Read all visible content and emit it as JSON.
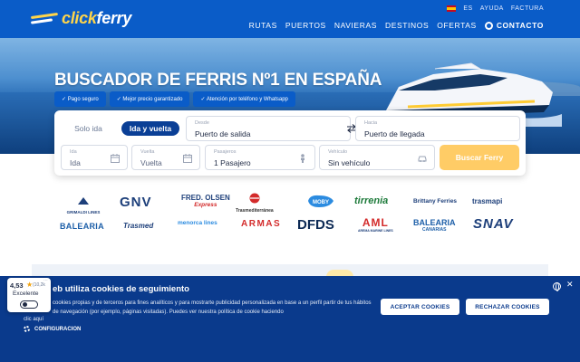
{
  "header": {
    "logo_part1": "click",
    "logo_part2": "ferry",
    "top_links": [
      "ES",
      "AYUDA",
      "FACTURA"
    ],
    "nav": [
      "RUTAS",
      "PUERTOS",
      "NAVIERAS",
      "DESTINOS",
      "OFERTAS"
    ],
    "contact_label": "CONTACTO"
  },
  "hero": {
    "title": "BUSCADOR DE FERRIS Nº1 EN ESPAÑA",
    "badges": [
      "✓ Pago seguro",
      "✓ Mejor precio garantizado",
      "✓ Atención por teléfono y Whatsapp"
    ]
  },
  "search": {
    "trip_one_way": "Solo ida",
    "trip_round": "Ida y vuelta",
    "from_label": "Desde",
    "from_value": "Puerto de salida",
    "to_label": "Hacia",
    "to_value": "Puerto de llegada",
    "date_out_label": "Ida",
    "date_out_value": "Ida",
    "date_back_label": "Vuelta",
    "date_back_value": "Vuelta",
    "passengers_label": "Pasajeros",
    "passengers_value": "1 Pasajero",
    "vehicle_label": "Vehículo",
    "vehicle_value": "Sin vehículo",
    "button": "Buscar Ferry"
  },
  "carriers": {
    "grimaldi": "GRIMALDI LINES",
    "gnv": "GNV",
    "fredolsen_1": "FRED. OLSEN",
    "fredolsen_2": "Express",
    "trasmed_alt": "Trasmediterránea",
    "moby": "MOBY",
    "tirrenia": "tirrenia",
    "brittany": "Brittany Ferries",
    "trasmapi": "trasmapi",
    "balearia": "BALEARIA",
    "trasmed": "Trasmed",
    "menorca": "menorca lines",
    "armas": "ARMAS",
    "dfds": "DFDS",
    "aml": "AML",
    "aml_sub": "AREMA MARINE LINES",
    "balearia_canarias_1": "BALEARIA",
    "balearia_canarias_2": "CANARIAS",
    "snav": "SNAV"
  },
  "cookie": {
    "title": "eb utiliza cookies de seguimiento",
    "text": "cookies propias y de terceros para fines analíticos y para mostrarte publicidad personalizada en base a un perfil partir de tus hábitos de navegación (por ejemplo, páginas visitadas). Puedes ver nuestra política de cookie haciendo",
    "text2": "clic aquí",
    "config": "CONFIGURACION",
    "accept": "ACEPTAR COOKIES",
    "reject": "RECHAZAR COOKIES"
  },
  "rating": {
    "score": "4,53",
    "count": "(10,2k",
    "label": "Excelente"
  },
  "colors": {
    "brand_blue": "#0a5cc8",
    "dark_blue": "#0a3a8c",
    "accent_yellow": "#ffcc66"
  }
}
